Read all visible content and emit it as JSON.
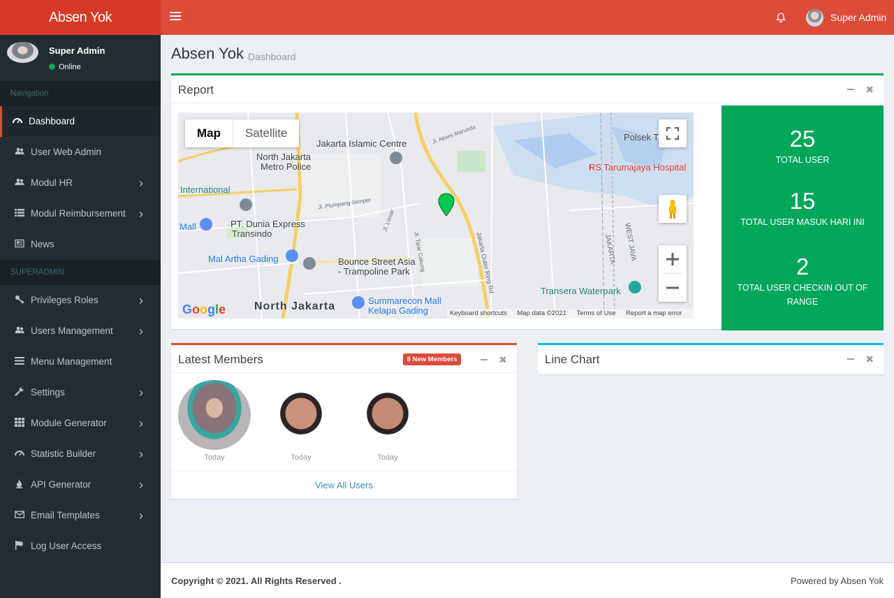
{
  "app": {
    "logo": "Absen Yok"
  },
  "topbar": {
    "user_name": "Super Admin"
  },
  "sidebar": {
    "user_name": "Super Admin",
    "status": "Online",
    "sections": [
      {
        "label": "Navigation",
        "items": [
          {
            "label": "Dashboard",
            "icon": "dashboard-icon",
            "active": true,
            "chevron": false
          },
          {
            "label": "User Web Admin",
            "icon": "users-icon",
            "chevron": false
          },
          {
            "label": "Modul HR",
            "icon": "users-icon",
            "chevron": true
          },
          {
            "label": "Modul Reimbursement",
            "icon": "list-icon",
            "chevron": true
          },
          {
            "label": "News",
            "icon": "newspaper-icon",
            "chevron": false
          }
        ]
      },
      {
        "label": "SUPERADMIN",
        "items": [
          {
            "label": "Privileges Roles",
            "icon": "key-icon",
            "chevron": true
          },
          {
            "label": "Users Management",
            "icon": "users-icon",
            "chevron": true
          },
          {
            "label": "Menu Management",
            "icon": "bars-icon",
            "chevron": false
          },
          {
            "label": "Settings",
            "icon": "wrench-icon",
            "chevron": true
          },
          {
            "label": "Module Generator",
            "icon": "grid-icon",
            "chevron": true
          },
          {
            "label": "Statistic Builder",
            "icon": "dashboard-icon",
            "chevron": true
          },
          {
            "label": "API Generator",
            "icon": "fire-icon",
            "chevron": true
          },
          {
            "label": "Email Templates",
            "icon": "envelope-icon",
            "chevron": true
          },
          {
            "label": "Log User Access",
            "icon": "flag-icon",
            "chevron": false
          }
        ]
      }
    ]
  },
  "page": {
    "title": "Absen Yok",
    "subtitle": "Dashboard"
  },
  "report": {
    "title": "Report",
    "map": {
      "tabs": [
        "Map",
        "Satellite"
      ],
      "labels": [
        "Jakarta Islamic Centre",
        "North Jakarta",
        "Metro Police",
        "International",
        "PT. Dunia Express",
        "Transindo",
        "Mall",
        "Mal Artha Gading",
        "Bounce Street Asia",
        "- Trampoline Park",
        "North Jakarta",
        "Summarecon Mall",
        "Kelapa Gading",
        "Polsek T",
        "RS Tarumajaya Hospital",
        "Transera Waterpark",
        "WEST JAVA",
        "JAKARTA",
        "Jakarta Outer Ring Rd",
        "Jl. Plumpang Semper",
        "Jl. Lontar",
        "Jl. Tipar Cakung",
        "Jl. Akses Marunda"
      ],
      "attribution": [
        "Keyboard shortcuts",
        "Map data ©2021",
        "Terms of Use",
        "Report a map error"
      ],
      "logo": "Google"
    },
    "stats": [
      {
        "value": "25",
        "label": "TOTAL USER"
      },
      {
        "value": "15",
        "label": "TOTAL USER MASUK HARI INI"
      },
      {
        "value": "2",
        "label": "TOTAL USER CHECKIN OUT OF RANGE"
      }
    ]
  },
  "members": {
    "title": "Latest Members",
    "badge": "8 New Members",
    "list": [
      {
        "when": "Today"
      },
      {
        "when": "Today"
      },
      {
        "when": "Today"
      }
    ],
    "view_all": "View All Users"
  },
  "line_chart": {
    "title": "Line Chart"
  },
  "footer": {
    "copyright": "Copyright © 2021. All Rights Reserved .",
    "powered": "Powered by Absen Yok"
  }
}
